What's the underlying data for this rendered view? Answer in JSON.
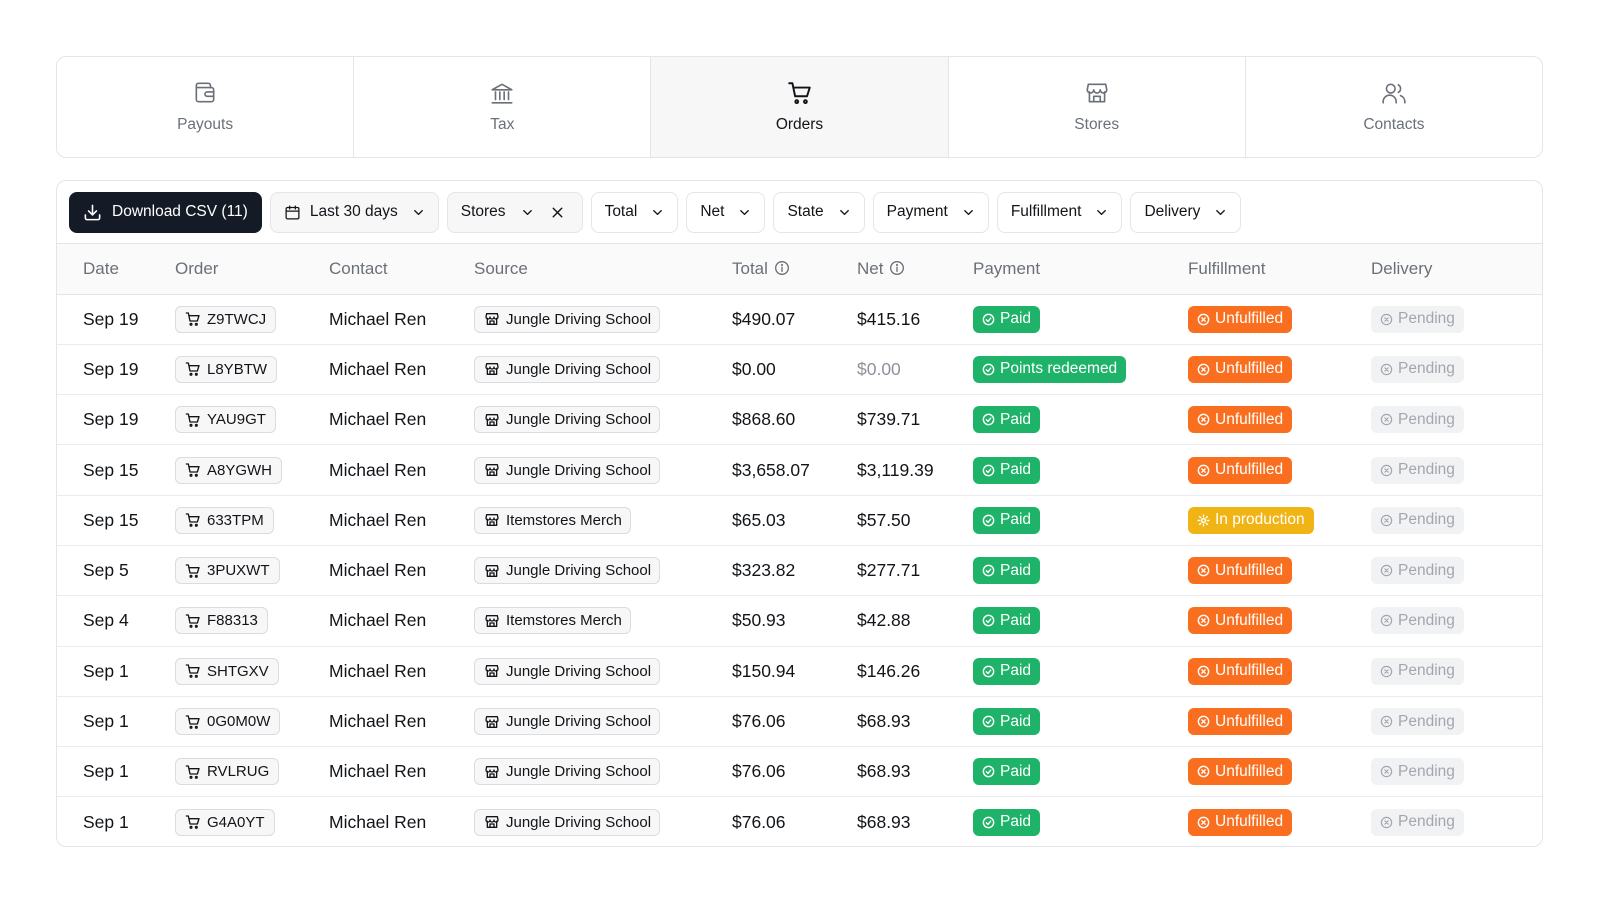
{
  "tabs": [
    {
      "label": "Payouts",
      "icon": "wallet-icon",
      "active": false
    },
    {
      "label": "Tax",
      "icon": "bank-icon",
      "active": false
    },
    {
      "label": "Orders",
      "icon": "cart-icon",
      "active": true
    },
    {
      "label": "Stores",
      "icon": "store-icon",
      "active": false
    },
    {
      "label": "Contacts",
      "icon": "users-icon",
      "active": false
    }
  ],
  "toolbar": {
    "download_label": "Download CSV (11)",
    "date_filter_label": "Last 30 days",
    "stores_filter_label": "Stores",
    "filters": [
      "Total",
      "Net",
      "State",
      "Payment",
      "Fulfillment",
      "Delivery"
    ]
  },
  "table": {
    "columns": [
      "Date",
      "Order",
      "Contact",
      "Source",
      "Total",
      "Net",
      "Payment",
      "Fulfillment",
      "Delivery"
    ],
    "rows": [
      {
        "date": "Sep 19",
        "order": "Z9TWCJ",
        "contact": "Michael Ren",
        "source": "Jungle Driving School",
        "total": "$490.07",
        "net": "$415.16",
        "net_muted": false,
        "payment": "Paid",
        "fulfillment": "Unfulfilled",
        "fulfillment_color": "orange",
        "delivery": "Pending"
      },
      {
        "date": "Sep 19",
        "order": "L8YBTW",
        "contact": "Michael Ren",
        "source": "Jungle Driving School",
        "total": "$0.00",
        "net": "$0.00",
        "net_muted": true,
        "payment": "Points redeemed",
        "fulfillment": "Unfulfilled",
        "fulfillment_color": "orange",
        "delivery": "Pending"
      },
      {
        "date": "Sep 19",
        "order": "YAU9GT",
        "contact": "Michael Ren",
        "source": "Jungle Driving School",
        "total": "$868.60",
        "net": "$739.71",
        "net_muted": false,
        "payment": "Paid",
        "fulfillment": "Unfulfilled",
        "fulfillment_color": "orange",
        "delivery": "Pending"
      },
      {
        "date": "Sep 15",
        "order": "A8YGWH",
        "contact": "Michael Ren",
        "source": "Jungle Driving School",
        "total": "$3,658.07",
        "net": "$3,119.39",
        "net_muted": false,
        "payment": "Paid",
        "fulfillment": "Unfulfilled",
        "fulfillment_color": "orange",
        "delivery": "Pending"
      },
      {
        "date": "Sep 15",
        "order": "633TPM",
        "contact": "Michael Ren",
        "source": "Itemstores Merch",
        "total": "$65.03",
        "net": "$57.50",
        "net_muted": false,
        "payment": "Paid",
        "fulfillment": "In production",
        "fulfillment_color": "yellow",
        "delivery": "Pending"
      },
      {
        "date": "Sep 5",
        "order": "3PUXWT",
        "contact": "Michael Ren",
        "source": "Jungle Driving School",
        "total": "$323.82",
        "net": "$277.71",
        "net_muted": false,
        "payment": "Paid",
        "fulfillment": "Unfulfilled",
        "fulfillment_color": "orange",
        "delivery": "Pending"
      },
      {
        "date": "Sep 4",
        "order": "F88313",
        "contact": "Michael Ren",
        "source": "Itemstores Merch",
        "total": "$50.93",
        "net": "$42.88",
        "net_muted": false,
        "payment": "Paid",
        "fulfillment": "Unfulfilled",
        "fulfillment_color": "orange",
        "delivery": "Pending"
      },
      {
        "date": "Sep 1",
        "order": "SHTGXV",
        "contact": "Michael Ren",
        "source": "Jungle Driving School",
        "total": "$150.94",
        "net": "$146.26",
        "net_muted": false,
        "payment": "Paid",
        "fulfillment": "Unfulfilled",
        "fulfillment_color": "orange",
        "delivery": "Pending"
      },
      {
        "date": "Sep 1",
        "order": "0G0M0W",
        "contact": "Michael Ren",
        "source": "Jungle Driving School",
        "total": "$76.06",
        "net": "$68.93",
        "net_muted": false,
        "payment": "Paid",
        "fulfillment": "Unfulfilled",
        "fulfillment_color": "orange",
        "delivery": "Pending"
      },
      {
        "date": "Sep 1",
        "order": "RVLRUG",
        "contact": "Michael Ren",
        "source": "Jungle Driving School",
        "total": "$76.06",
        "net": "$68.93",
        "net_muted": false,
        "payment": "Paid",
        "fulfillment": "Unfulfilled",
        "fulfillment_color": "orange",
        "delivery": "Pending"
      },
      {
        "date": "Sep 1",
        "order": "G4A0YT",
        "contact": "Michael Ren",
        "source": "Jungle Driving School",
        "total": "$76.06",
        "net": "$68.93",
        "net_muted": false,
        "payment": "Paid",
        "fulfillment": "Unfulfilled",
        "fulfillment_color": "orange",
        "delivery": "Pending"
      }
    ]
  },
  "colors": {
    "dark_button": "#141b26",
    "paid_green": "#1fb36a",
    "unfulfilled_orange": "#fa6f1f",
    "in_production_yellow": "#f0b415",
    "pending_grey": "#f1f2f4"
  }
}
